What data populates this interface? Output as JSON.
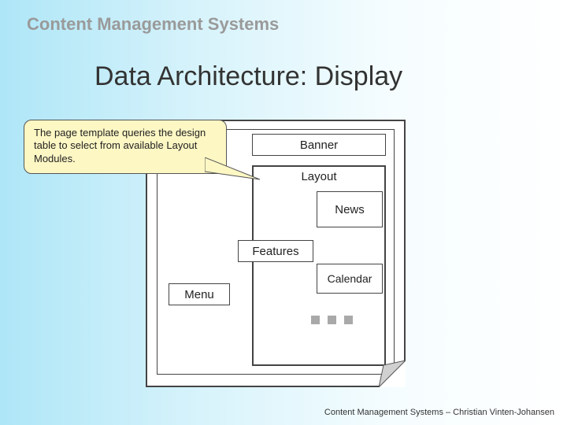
{
  "header": {
    "title": "Content Management Systems"
  },
  "slide": {
    "title": "Data Architecture: Display"
  },
  "callout": {
    "text": "The page template queries the design table to select from available Layout Modules."
  },
  "page": {
    "banner": "Banner",
    "layout": "Layout",
    "news": "News",
    "features": "Features",
    "calendar": "Calendar",
    "menu": "Menu"
  },
  "footer": {
    "text": "Content Management Systems – Christian Vinten-Johansen"
  }
}
